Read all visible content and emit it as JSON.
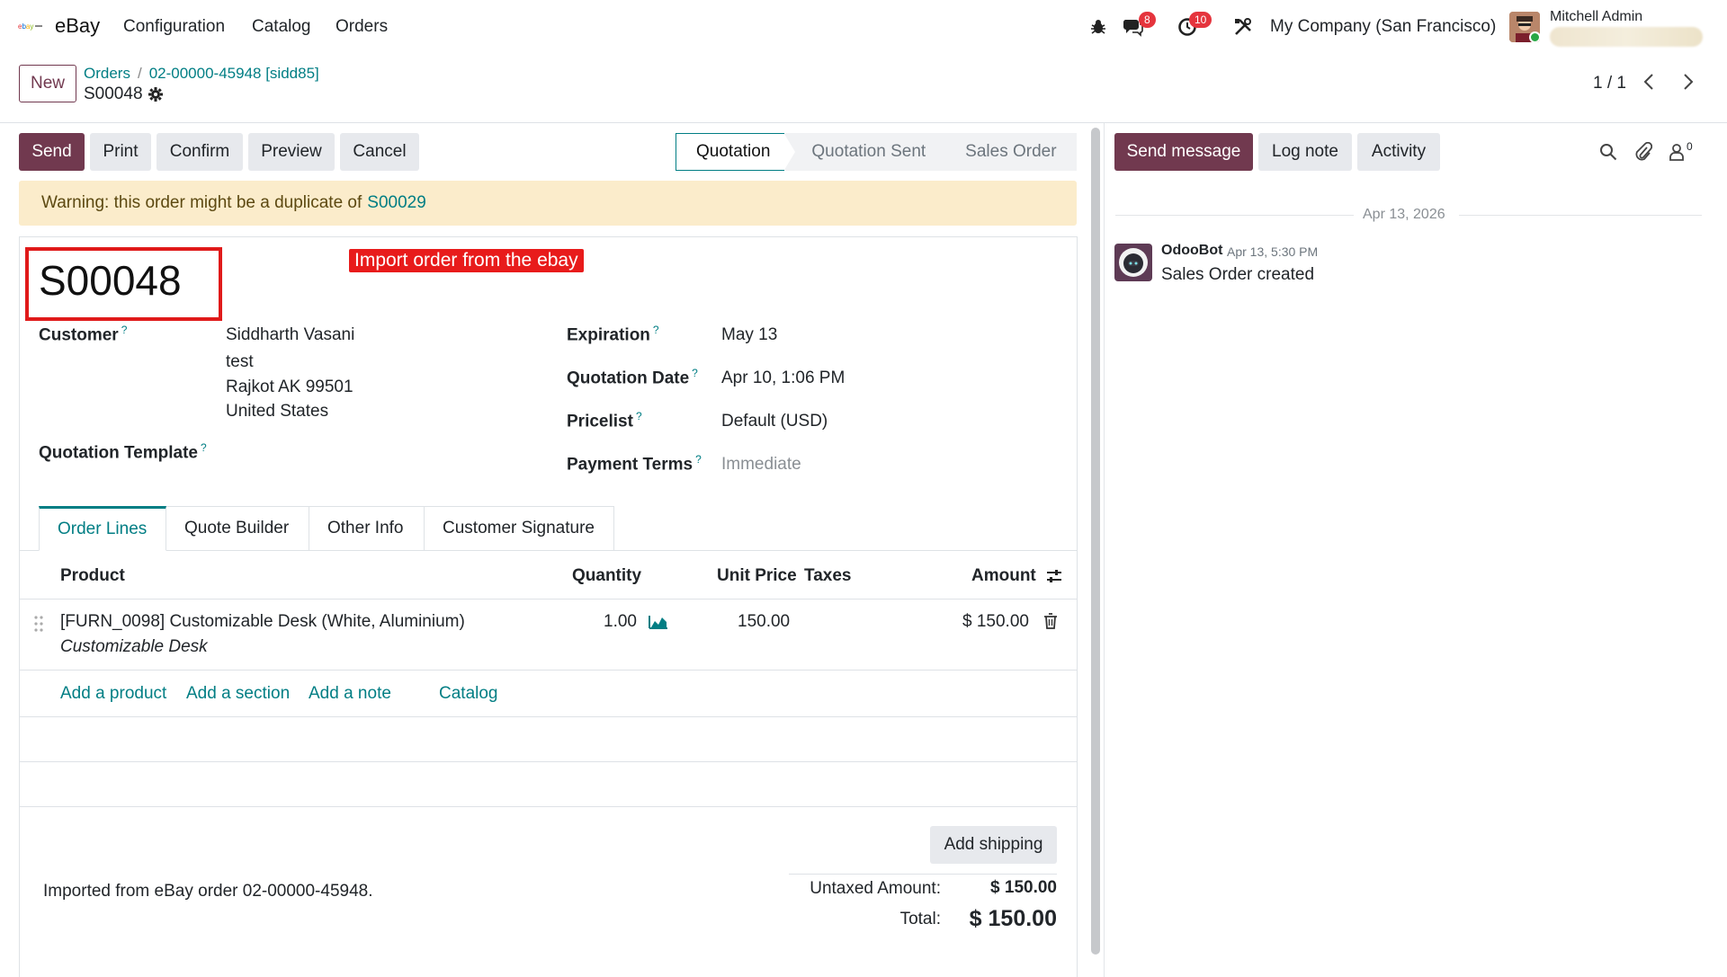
{
  "nav": {
    "app_name": "eBay",
    "menu": [
      "Configuration",
      "Catalog",
      "Orders"
    ],
    "messages_badge": "8",
    "activity_badge": "10",
    "company": "My Company (San Francisco)",
    "user_name": "Mitchell Admin"
  },
  "control": {
    "new_label": "New",
    "breadcrumb": [
      "Orders",
      "02-00000-45948 [sidd85]"
    ],
    "record": "S00048",
    "pager": "1 / 1"
  },
  "actions": {
    "send": "Send",
    "print": "Print",
    "confirm": "Confirm",
    "preview": "Preview",
    "cancel": "Cancel"
  },
  "statusbar": {
    "stages": [
      "Quotation",
      "Quotation Sent",
      "Sales Order"
    ],
    "active": "Quotation"
  },
  "warning": {
    "text": "Warning: this order might be a duplicate of",
    "link": "S00029"
  },
  "form": {
    "name": "S00048",
    "annotation": "Import order from the ebay",
    "customer_label": "Customer",
    "customer_lines": [
      "Siddharth Vasani",
      "test",
      "Rajkot AK 99501",
      "United States"
    ],
    "template_label": "Quotation Template",
    "expiration_label": "Expiration",
    "expiration": "May 13",
    "quotation_date_label": "Quotation Date",
    "quotation_date": "Apr 10, 1:06 PM",
    "pricelist_label": "Pricelist",
    "pricelist": "Default (USD)",
    "payment_terms_label": "Payment Terms",
    "payment_terms": "Immediate",
    "help_mark": "?"
  },
  "tabs": [
    "Order Lines",
    "Quote Builder",
    "Other Info",
    "Customer Signature"
  ],
  "order_lines": {
    "headers": {
      "product": "Product",
      "quantity": "Quantity",
      "unit_price": "Unit Price",
      "taxes": "Taxes",
      "amount": "Amount"
    },
    "rows": [
      {
        "product": "[FURN_0098] Customizable Desk (White, Aluminium)",
        "description": "Customizable Desk",
        "quantity": "1.00",
        "unit_price": "150.00",
        "taxes": "",
        "amount": "$ 150.00"
      }
    ],
    "links": {
      "add_product": "Add a product",
      "add_section": "Add a section",
      "add_note": "Add a note",
      "catalog": "Catalog"
    }
  },
  "totals": {
    "add_shipping": "Add shipping",
    "note": "Imported from eBay order 02-00000-45948.",
    "untaxed_label": "Untaxed Amount:",
    "untaxed": "$ 150.00",
    "total_label": "Total:",
    "total": "$ 150.00"
  },
  "chatter": {
    "send_message": "Send message",
    "log_note": "Log note",
    "activity": "Activity",
    "followers_count": "0",
    "date_separator": "Apr 13, 2026",
    "messages": [
      {
        "author": "OdooBot",
        "time": "Apr 13, 5:30 PM",
        "body": "Sales Order created"
      }
    ]
  },
  "colors": {
    "primary": "#71394f",
    "link": "#017e84",
    "warning_bg": "#fbeccb",
    "annotation_red": "#e81b1b"
  },
  "icons": [
    "ebay-logo-icon",
    "bug-icon",
    "chat-icon",
    "clock-icon",
    "tools-icon",
    "gear-icon",
    "chevron-left-icon",
    "chevron-right-icon",
    "drag-handle-icon",
    "forecast-chart-icon",
    "trash-icon",
    "column-settings-icon",
    "search-icon",
    "paperclip-icon",
    "followers-icon",
    "odoobot-avatar-icon"
  ]
}
